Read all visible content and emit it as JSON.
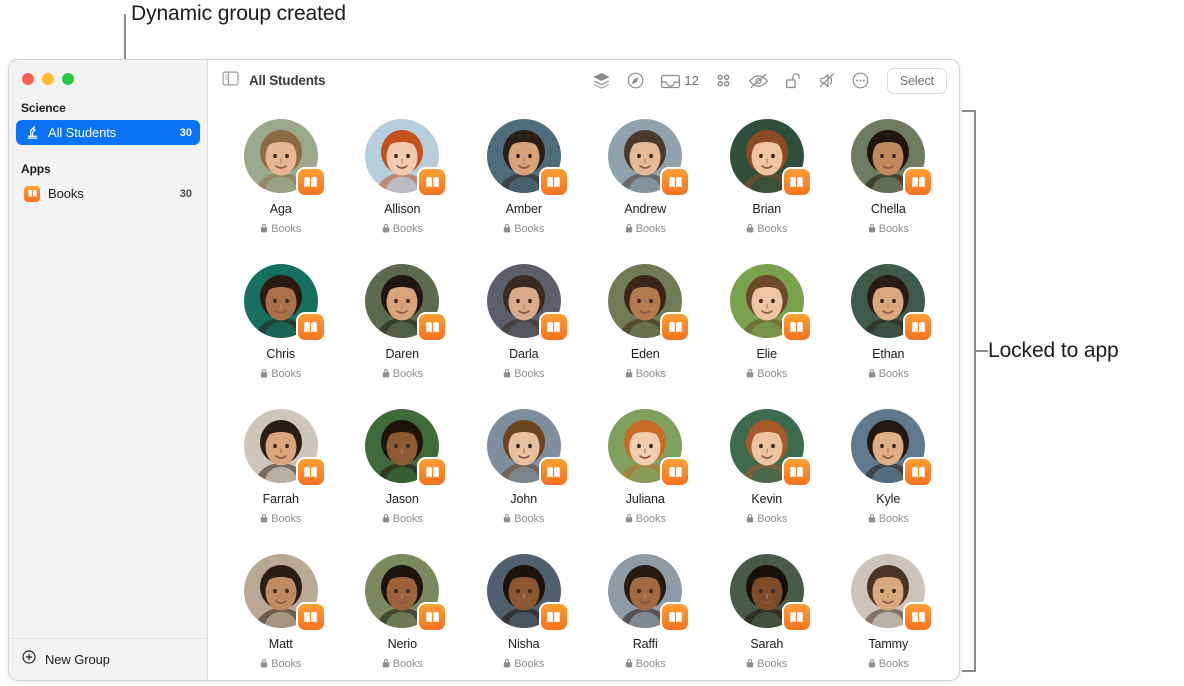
{
  "annotations": {
    "top_callout": "Dynamic group created",
    "right_callout": "Locked to app"
  },
  "window": {
    "traffic_lights": [
      "close",
      "minimize",
      "maximize"
    ]
  },
  "sidebar": {
    "groups": [
      {
        "title": "Science",
        "items": [
          {
            "label": "All Students",
            "count": "30",
            "icon": "microscope-icon",
            "selected": true
          }
        ]
      },
      {
        "title": "Apps",
        "items": [
          {
            "label": "Books",
            "count": "30",
            "icon": "books-app-icon",
            "selected": false
          }
        ]
      }
    ],
    "new_group_label": "New Group"
  },
  "toolbar": {
    "sidebar_toggle_icon": "sidebar-toggle-icon",
    "title": "All Students",
    "actions": [
      {
        "name": "layers-icon",
        "label": ""
      },
      {
        "name": "compass-icon",
        "label": ""
      },
      {
        "name": "inbox-icon",
        "label": "12"
      },
      {
        "name": "grid-icon",
        "label": ""
      },
      {
        "name": "hidden-eye-icon",
        "label": ""
      },
      {
        "name": "unlocked-padlock-icon",
        "label": ""
      },
      {
        "name": "mute-icon",
        "label": ""
      },
      {
        "name": "more-options-icon",
        "label": ""
      }
    ],
    "select_label": "Select"
  },
  "colors": {
    "accent_blue": "#0a72f5",
    "books_orange": "#f5721f",
    "sidebar_bg": "#f3f3f3",
    "traffic_red": "#ff5f57",
    "traffic_yellow": "#febc2e",
    "traffic_green": "#28c840"
  },
  "main": {
    "app_label": "Books",
    "lock_icon": "lock-icon",
    "students": [
      {
        "name": "Aga",
        "app": "Books",
        "skin": "#e7b793",
        "hair": "#8c6a42",
        "bg": "#9aa98c"
      },
      {
        "name": "Allison",
        "app": "Books",
        "skin": "#f0cbb0",
        "hair": "#c4521f",
        "bg": "#b6cede"
      },
      {
        "name": "Amber",
        "app": "Books",
        "skin": "#d9a37a",
        "hair": "#2c1d16",
        "bg": "#4e6b79"
      },
      {
        "name": "Andrew",
        "app": "Books",
        "skin": "#e5bb97",
        "hair": "#4b3a2c",
        "bg": "#8fa2ad"
      },
      {
        "name": "Brian",
        "app": "Books",
        "skin": "#f0c4a0",
        "hair": "#8a4a22",
        "bg": "#2f4f3a"
      },
      {
        "name": "Chella",
        "app": "Books",
        "skin": "#c18a5e",
        "hair": "#1f1410",
        "bg": "#6d7b5e"
      },
      {
        "name": "Chris",
        "app": "Books",
        "skin": "#a9714a",
        "hair": "#2a1a12",
        "bg": "#17705f"
      },
      {
        "name": "Daren",
        "app": "Books",
        "skin": "#d9a479",
        "hair": "#201713",
        "bg": "#5c6b4e"
      },
      {
        "name": "Darla",
        "app": "Books",
        "skin": "#d9a98a",
        "hair": "#3a2a22",
        "bg": "#5a5f6b"
      },
      {
        "name": "Eden",
        "app": "Books",
        "skin": "#b37a4f",
        "hair": "#3b2418",
        "bg": "#6f7b55"
      },
      {
        "name": "Elie",
        "app": "Books",
        "skin": "#eec4a3",
        "hair": "#6b4a2c",
        "bg": "#7aa24e"
      },
      {
        "name": "Ethan",
        "app": "Books",
        "skin": "#d9a87f",
        "hair": "#2a1c14",
        "bg": "#3e5a4a"
      },
      {
        "name": "Farrah",
        "app": "Books",
        "skin": "#d8a57d",
        "hair": "#2b1d16",
        "bg": "#cfc6bb"
      },
      {
        "name": "Jason",
        "app": "Books",
        "skin": "#8d5a33",
        "hair": "#1d120c",
        "bg": "#3f6b3a"
      },
      {
        "name": "John",
        "app": "Books",
        "skin": "#e9c0a0",
        "hair": "#6b4423",
        "bg": "#7e8e9c"
      },
      {
        "name": "Juliana",
        "app": "Books",
        "skin": "#f2cdae",
        "hair": "#c96a28",
        "bg": "#7fa05e"
      },
      {
        "name": "Kevin",
        "app": "Books",
        "skin": "#ecc4a2",
        "hair": "#a8582a",
        "bg": "#3e6b4e"
      },
      {
        "name": "Kyle",
        "app": "Books",
        "skin": "#dfae84",
        "hair": "#241810",
        "bg": "#5f7a8e"
      },
      {
        "name": "Matt",
        "app": "Books",
        "skin": "#c08b60",
        "hair": "#2c1d14",
        "bg": "#b8a894"
      },
      {
        "name": "Nerio",
        "app": "Books",
        "skin": "#9c6238",
        "hair": "#1e130d",
        "bg": "#7a8a5e"
      },
      {
        "name": "Nisha",
        "app": "Books",
        "skin": "#8b5630",
        "hair": "#1b110b",
        "bg": "#4f5f6e"
      },
      {
        "name": "Raffi",
        "app": "Books",
        "skin": "#a06b42",
        "hair": "#271a12",
        "bg": "#8e9aa4"
      },
      {
        "name": "Sarah",
        "app": "Books",
        "skin": "#7d4d2a",
        "hair": "#17100a",
        "bg": "#4a5a48"
      },
      {
        "name": "Tammy",
        "app": "Books",
        "skin": "#d9a87f",
        "hair": "#4a3224",
        "bg": "#ccc4bb"
      }
    ]
  }
}
